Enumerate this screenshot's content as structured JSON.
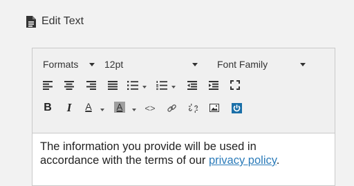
{
  "header": {
    "icon": "document-icon",
    "title": "Edit Text"
  },
  "toolbar": {
    "formats_label": "Formats",
    "font_size_value": "12pt",
    "font_family_label": "Font Family",
    "buttons": [
      "align-left-icon",
      "align-center-icon",
      "align-right-icon",
      "align-justify-icon",
      "bullet-list-icon",
      "numbered-list-icon",
      "outdent-icon",
      "indent-icon",
      "fullscreen-icon",
      "bold-icon",
      "italic-icon",
      "text-color-icon",
      "background-color-icon",
      "source-code-icon",
      "link-icon",
      "unlink-icon",
      "image-icon",
      "power-icon"
    ],
    "bold_label": "B",
    "italic_label": "I",
    "text_color_label": "A",
    "bg_color_label": "A",
    "code_label": "<>"
  },
  "content": {
    "line1": "The information you provide will be used in",
    "line2_prefix": "accordance with the terms of our ",
    "link_text": "privacy policy",
    "line2_suffix": "."
  },
  "colors": {
    "link": "#2b7bb9",
    "power_button": "#1a6fa8",
    "background": "#f2f2f2"
  }
}
